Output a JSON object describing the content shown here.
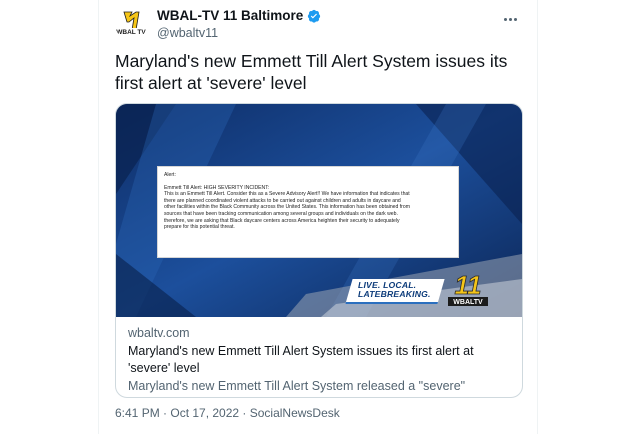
{
  "account": {
    "display_name": "WBAL-TV 11 Baltimore",
    "handle": "@wbaltv11",
    "verified": true,
    "avatar_text": "WBAL TV",
    "avatar_number": "11"
  },
  "tweet": {
    "text": "Maryland's new Emmett Till Alert System issues its first alert at 'severe' level"
  },
  "card": {
    "domain": "wbaltv.com",
    "title": "Maryland's new Emmett Till Alert System issues its first alert at 'severe' level",
    "description": "Maryland's new Emmett Till Alert System released a \"severe\" warning Sunday night that involves threats of possible violence against Black child care centers.",
    "image": {
      "alert_lines": [
        "Alert:",
        "",
        "Emmett Till Alert: HIGH SEVERITY INCIDENT:",
        "This is an Emmett Till Alert. Consider this as a Severe Advisory Alert!! We have information that indicates that",
        "there are planned coordinated violent attacks to be carried out against children and adults in daycare and",
        "other facilities within the Black Community across the United States. This information has been obtained from",
        "sources that have been tracking communication among several groups and individuals on the dark web.",
        "therefore, we are asking that Black daycare centers across America heighten their security to adequately",
        "prepare for this potential threat."
      ],
      "banner_line1": "LIVE. LOCAL.",
      "banner_line2": "LATEBREAKING.",
      "logo_number": "11",
      "logo_text": "WBALTV"
    }
  },
  "meta": {
    "timestamp": "6:41 PM · Oct 17, 2022 · SocialNewsDesk"
  },
  "colors": {
    "text_primary": "#0f1419",
    "text_secondary": "#536471",
    "verified_blue": "#1d9bf0",
    "logo_yellow": "#f5c518",
    "image_blue": "#1b4b94"
  }
}
